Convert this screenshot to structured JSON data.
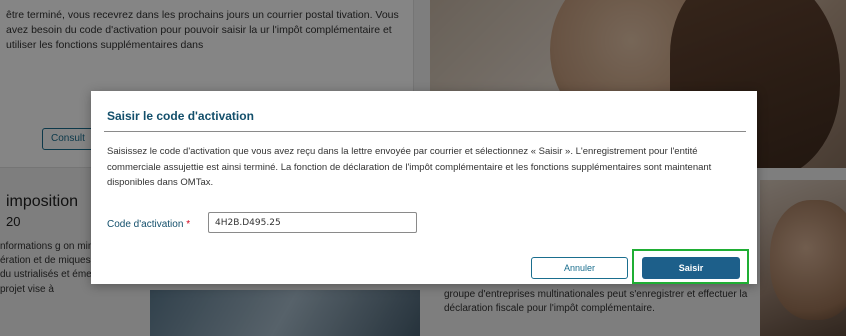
{
  "background": {
    "intro_text": "être terminé, vous recevrez dans les prochains jours un courrier postal tivation. Vous avez besoin du code d'activation pour pouvoir saisir la ur l'impôt complémentaire et utiliser les fonctions supplémentaires dans",
    "consult_button_label": "Consult",
    "section_title": "imposition",
    "section_year": "20",
    "left_body": "nformations g on minimale d ération et de miques (OCDE) et du ustrialisés et émergents 0). Ce projet vise à",
    "mid_body": "groupe d'entreprises multinationales peut s'enregistrer et effectuer la déclaration fiscale pour l'impôt complémentaire."
  },
  "modal": {
    "title": "Saisir le code d'activation",
    "body": "Saisissez le code d'activation que vous avez reçu dans la lettre envoyée par courrier et sélectionnez « Saisir ». L'enregistrement pour l'entité commerciale assujettie est ainsi terminé. La fonction de déclaration de l'impôt complémentaire et les fonctions supplémentaires sont maintenant disponibles dans OMTax.",
    "field_label": "Code d'activation",
    "required_marker": "*",
    "field_value": "4H2B.D495.25",
    "cancel_label": "Annuler",
    "submit_label": "Saisir"
  },
  "colors": {
    "accent": "#134f6b",
    "primary_button": "#1d5f8a",
    "highlight": "#1fae34",
    "required": "#d0021b"
  }
}
